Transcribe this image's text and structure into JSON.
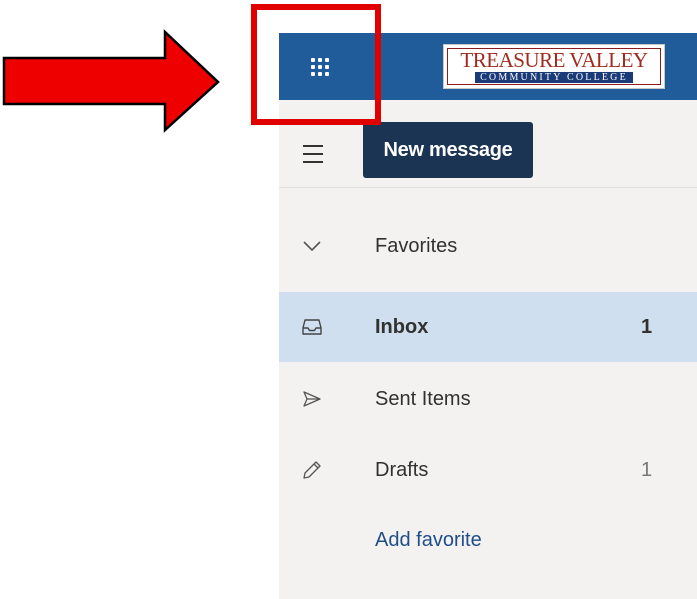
{
  "annotation": {
    "highlight_color": "#e00000",
    "target": "app-launcher-button"
  },
  "header": {
    "background": "#1f5c99",
    "logo_top_text": "TREASURE VALLEY",
    "logo_bottom_text": "COMMUNITY COLLEGE",
    "launcher_icon": "waffle-icon"
  },
  "toolbar": {
    "menu_icon": "hamburger-icon",
    "new_message_label": "New message"
  },
  "nav": {
    "favorites": {
      "label": "Favorites",
      "icon": "chevron-down-icon"
    },
    "items": [
      {
        "label": "Inbox",
        "count": "1",
        "icon": "inbox-icon",
        "selected": true
      },
      {
        "label": "Sent Items",
        "count": "",
        "icon": "send-icon"
      },
      {
        "label": "Drafts",
        "count": "1",
        "icon": "pencil-icon"
      }
    ],
    "add_favorite_label": "Add favorite"
  }
}
